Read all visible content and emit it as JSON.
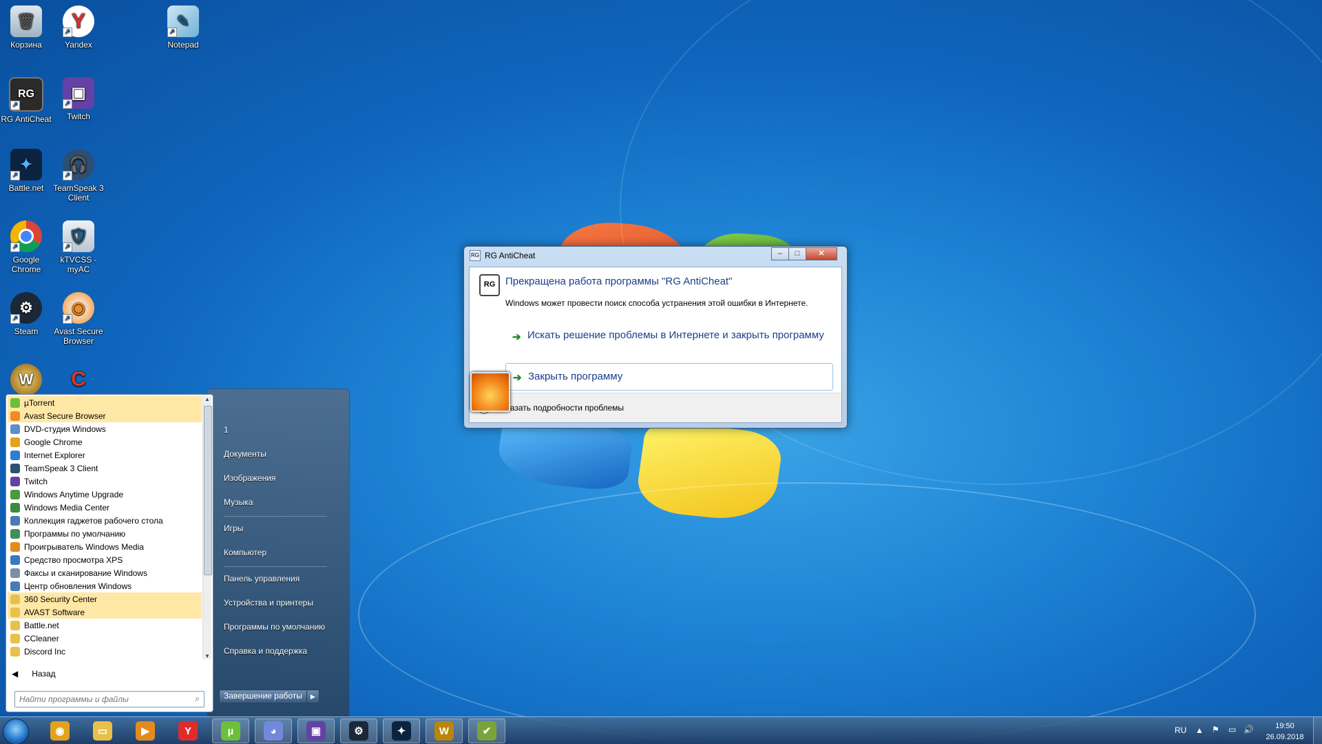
{
  "desktop": {
    "icons": [
      {
        "label": "Корзина",
        "icon": "recycle-bin-icon"
      },
      {
        "label": "Yandex",
        "icon": "yandex-icon"
      },
      {
        "label": "Notepad",
        "icon": "notepad-icon"
      },
      {
        "label": "RG AntiCheat",
        "icon": "rg-anticheat-icon"
      },
      {
        "label": "Twitch",
        "icon": "twitch-icon"
      },
      {
        "label": "Battle.net",
        "icon": "battlenet-icon"
      },
      {
        "label": "TeamSpeak 3 Client",
        "icon": "teamspeak-icon"
      },
      {
        "label": "Google Chrome",
        "icon": "chrome-icon"
      },
      {
        "label": "kTVCSS - myAC",
        "icon": "ktvcss-icon"
      },
      {
        "label": "Steam",
        "icon": "steam-icon"
      },
      {
        "label": "Avast Secure Browser",
        "icon": "avast-browser-icon"
      }
    ]
  },
  "dialog": {
    "title": "RG AntiCheat",
    "logo_text": "RG",
    "heading": "Прекращена работа программы \"RG AntiCheat\"",
    "subtitle": "Windows может провести поиск способа устранения этой ошибки в Интернете.",
    "option1": "Искать решение проблемы в Интернете и закрыть программу",
    "option2": "Закрыть программу",
    "details": "Показать подробности проблемы"
  },
  "start_menu": {
    "programs": [
      {
        "label": "µTorrent",
        "highlight": true,
        "color": "#6cbf3b"
      },
      {
        "label": "Avast Secure Browser",
        "highlight": true,
        "color": "#f08a24"
      },
      {
        "label": "DVD-студия Windows",
        "highlight": false,
        "color": "#5b8fc7"
      },
      {
        "label": "Google Chrome",
        "highlight": false,
        "color": "#e3a21a"
      },
      {
        "label": "Internet Explorer",
        "highlight": false,
        "color": "#2c7fd1"
      },
      {
        "label": "TeamSpeak 3 Client",
        "highlight": false,
        "color": "#2d4f73"
      },
      {
        "label": "Twitch",
        "highlight": false,
        "color": "#6441a5"
      },
      {
        "label": "Windows Anytime Upgrade",
        "highlight": false,
        "color": "#4a9b3a"
      },
      {
        "label": "Windows Media Center",
        "highlight": false,
        "color": "#3c8a3c"
      },
      {
        "label": "Коллекция гаджетов рабочего стола",
        "highlight": false,
        "color": "#4b7ab5"
      },
      {
        "label": "Программы по умолчанию",
        "highlight": false,
        "color": "#3f8f5a"
      },
      {
        "label": "Проигрыватель Windows Media",
        "highlight": false,
        "color": "#e38a1c"
      },
      {
        "label": "Средство просмотра XPS",
        "highlight": false,
        "color": "#3a78c2"
      },
      {
        "label": "Факсы и сканирование Windows",
        "highlight": false,
        "color": "#7b8ea3"
      },
      {
        "label": "Центр обновления Windows",
        "highlight": false,
        "color": "#4b7ab5"
      },
      {
        "label": "360 Security Center",
        "highlight": true,
        "color": "#e8c04a"
      },
      {
        "label": "AVAST Software",
        "highlight": true,
        "color": "#e8c04a"
      },
      {
        "label": "Battle.net",
        "highlight": false,
        "color": "#e8c04a"
      },
      {
        "label": "CCleaner",
        "highlight": false,
        "color": "#e8c04a"
      },
      {
        "label": "Discord Inc",
        "highlight": false,
        "color": "#e8c04a"
      }
    ],
    "back": "Назад",
    "search_placeholder": "Найти программы и файлы",
    "right_links": {
      "user": "1",
      "documents": "Документы",
      "images": "Изображения",
      "music": "Музыка",
      "games": "Игры",
      "computer": "Компьютер",
      "control_panel": "Панель управления",
      "devices": "Устройства и принтеры",
      "default_programs": "Программы по умолчанию",
      "help": "Справка и поддержка"
    },
    "shutdown": "Завершение работы"
  },
  "taskbar": {
    "buttons": [
      {
        "icon": "chrome-icon",
        "color": "#e3a21a",
        "glyph": "◉"
      },
      {
        "icon": "explorer-folder-icon",
        "color": "#e8c04a",
        "glyph": "▭"
      },
      {
        "icon": "media-player-icon",
        "color": "#e38a1c",
        "glyph": "▶"
      },
      {
        "icon": "yandex-icon",
        "color": "#e02b2b",
        "glyph": "Y"
      },
      {
        "icon": "utorrent-icon",
        "color": "#6cbf3b",
        "glyph": "µ"
      },
      {
        "icon": "discord-icon",
        "color": "#7289da",
        "glyph": "◕"
      },
      {
        "icon": "twitch-icon",
        "color": "#6441a5",
        "glyph": "▣"
      },
      {
        "icon": "steam-icon",
        "color": "#1b2838",
        "glyph": "⚙"
      },
      {
        "icon": "battlenet-icon",
        "color": "#0c2340",
        "glyph": "✦"
      },
      {
        "icon": "wow-icon",
        "color": "#b8860b",
        "glyph": "W"
      },
      {
        "icon": "rg-anticheat-icon",
        "color": "#7aa33a",
        "glyph": "✔"
      }
    ],
    "language": "RU",
    "time": "19:50",
    "date": "26.09.2018"
  }
}
